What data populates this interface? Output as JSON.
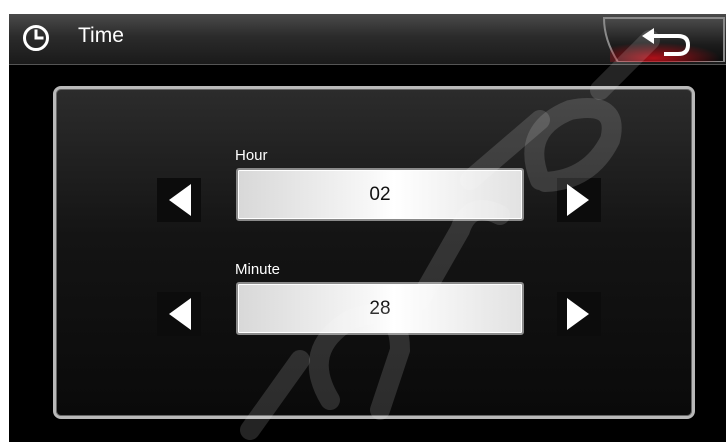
{
  "header": {
    "title": "Time"
  },
  "hour": {
    "label": "Hour",
    "value": "02"
  },
  "minute": {
    "label": "Minute",
    "value": "28"
  }
}
